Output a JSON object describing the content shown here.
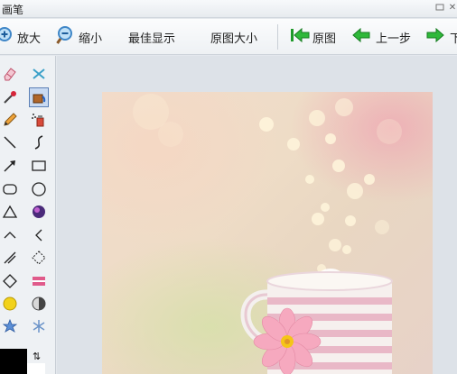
{
  "window": {
    "title": "画笔"
  },
  "toolbar": {
    "zoom_in": "放大",
    "zoom_out": "缩小",
    "best_fit": "最佳显示",
    "actual_size": "原图大小",
    "original": "原图",
    "previous": "上一步",
    "next_partial": "下"
  },
  "tools": [
    "eraser-icon",
    "color-replace-icon",
    "color-picker-icon",
    "fill-bucket-icon",
    "pencil-icon",
    "spray-icon",
    "line-icon",
    "curve-icon",
    "arrow-icon",
    "rectangle-icon",
    "rounded-rectangle-icon",
    "ellipse-icon",
    "triangle-icon",
    "sphere-icon",
    "angle-up-icon",
    "angle-left-icon",
    "diagonal-icon",
    "diamond-outline-icon",
    "diamond-icon",
    "ribbon-icon",
    "circle-yellow-icon",
    "half-circle-icon",
    "star-icon",
    "snowflake-icon"
  ],
  "selected_tool": "fill-bucket-icon",
  "colors": {
    "foreground": "#000000",
    "background": "#ffffff",
    "accent": "#1f9a2a"
  }
}
